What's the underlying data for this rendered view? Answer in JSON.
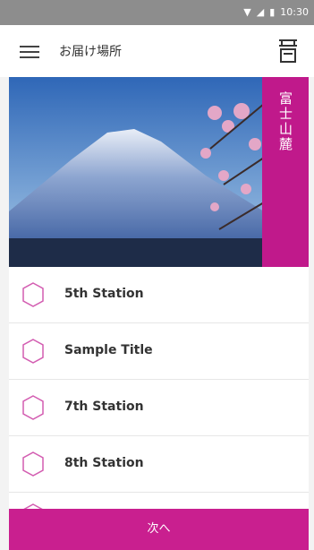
{
  "status_bar": {
    "time": "10:30"
  },
  "app_bar": {
    "title": "お届け場所"
  },
  "hero": {
    "banner_text": "富士山麓"
  },
  "list": {
    "items": [
      {
        "label": "5th Station"
      },
      {
        "label": "Sample Title"
      },
      {
        "label": "7th Station"
      },
      {
        "label": "8th Station"
      }
    ]
  },
  "footer": {
    "next_label": "次へ"
  },
  "colors": {
    "accent": "#c91f8f",
    "status_bar": "#8d8d8d",
    "hex_outline": "#d35db1"
  },
  "icons": {
    "menu": "hamburger-icon",
    "right": "box-icon",
    "wifi": "wifi-icon",
    "signal": "signal-icon",
    "battery": "battery-icon",
    "list_item": "hexagon-icon"
  }
}
